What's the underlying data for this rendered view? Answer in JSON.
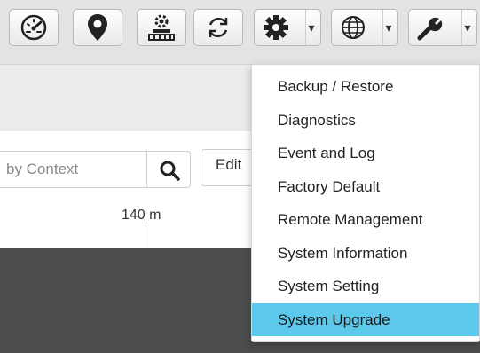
{
  "toolbar": {
    "buttons": [
      {
        "icon": "dashboard-icon"
      },
      {
        "icon": "location-pin-icon"
      },
      {
        "icon": "network-gear-icon"
      },
      {
        "icon": "refresh-icon"
      },
      {
        "icon": "gear-icon",
        "dropdown": true
      },
      {
        "icon": "globe-icon",
        "dropdown": true
      },
      {
        "icon": "wrench-icon",
        "dropdown": true
      }
    ],
    "caret": "▾"
  },
  "search": {
    "placeholder": "by Context",
    "value": ""
  },
  "edit_label": "Edit",
  "scale_label": "140 m",
  "tools_menu": {
    "items": [
      "Backup / Restore",
      "Diagnostics",
      "Event and Log",
      "Factory Default",
      "Remote Management",
      "System Information",
      "System Setting",
      "System Upgrade"
    ],
    "active_index": 7
  },
  "colors": {
    "accent": "#5bc8ec",
    "map_dark": "#4c4d4f"
  }
}
